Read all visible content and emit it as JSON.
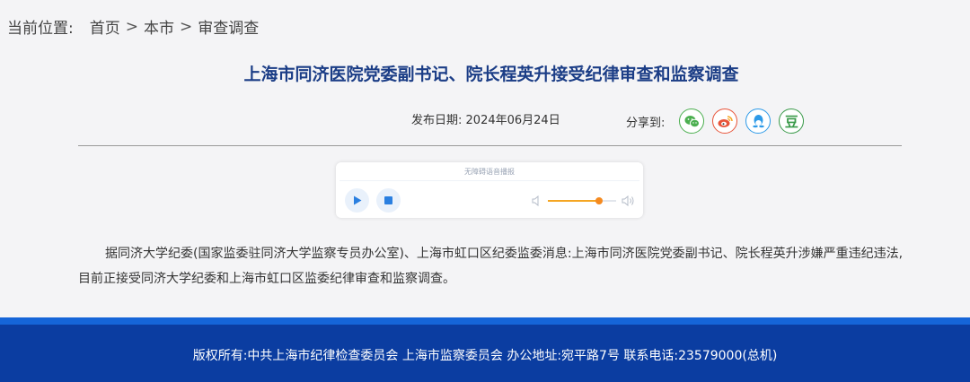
{
  "breadcrumb": {
    "label": "当前位置:",
    "items": [
      "首页",
      "本市",
      "审查调查"
    ],
    "separator": ">"
  },
  "article": {
    "title": "上海市同济医院党委副书记、院长程英升接受纪律审查和监察调查",
    "publish_label": "发布日期:",
    "publish_date": "2024年06月24日",
    "body": "据同济大学纪委(国家监委驻同济大学监察专员办公室)、上海市虹口区纪委监委消息:上海市同济医院党委副书记、院长程英升涉嫌严重违纪违法,目前正接受同济大学纪委和上海市虹口区监委纪律审查和监察调查。"
  },
  "share": {
    "label": "分享到:",
    "buttons": [
      {
        "name": "wechat",
        "icon": "wechat-icon",
        "color": "#4caf50"
      },
      {
        "name": "weibo",
        "icon": "weibo-icon",
        "color": "#e8543a"
      },
      {
        "name": "qq",
        "icon": "qq-icon",
        "color": "#2d9ae8"
      },
      {
        "name": "douban",
        "icon": "douban-icon",
        "glyph": "豆",
        "color": "#3a9a4a"
      }
    ]
  },
  "player": {
    "caption": "无障碍语音播报",
    "volume_level": 0.75,
    "accent": "#f5a623"
  },
  "footer": {
    "text": "版权所有:中共上海市纪律检查委员会 上海市监察委员会 办公地址:宛平路7号 联系电话:23579000(总机)",
    "bg_color": "#0b3da1",
    "bar_color": "#1565d8"
  }
}
